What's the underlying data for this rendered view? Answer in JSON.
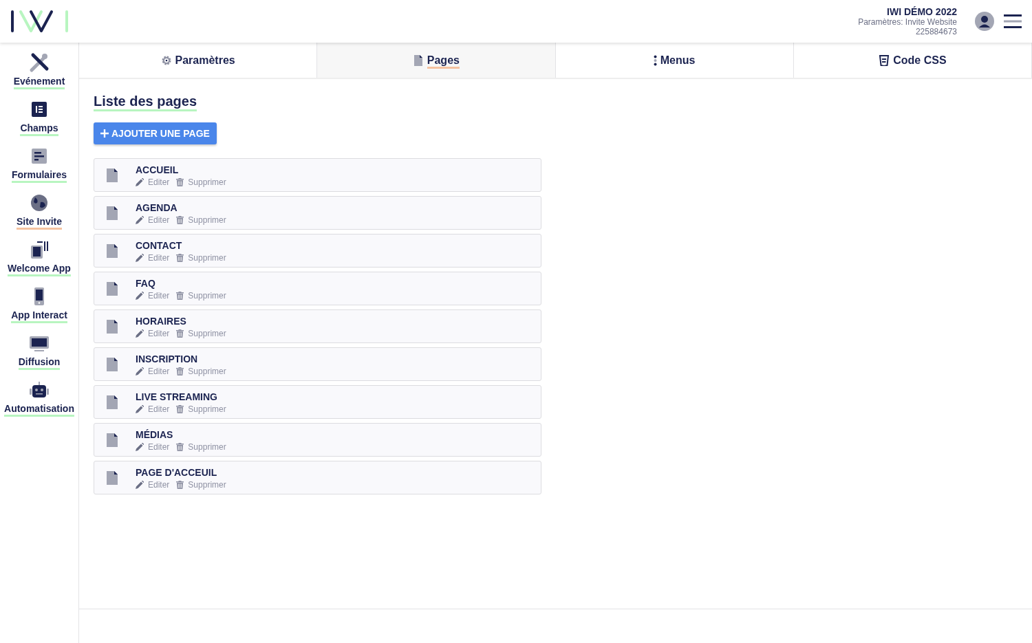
{
  "header": {
    "event_title": "IWI DÉMO 2022",
    "settings_line": "Paramètres: Invite Website",
    "event_id": "225884673"
  },
  "sidebar": {
    "items": [
      {
        "kind": "tools",
        "label": "Evénement",
        "selected": false
      },
      {
        "kind": "fields",
        "label": "Champs",
        "selected": false
      },
      {
        "kind": "form",
        "label": "Formulaires",
        "selected": false
      },
      {
        "kind": "globe",
        "label": "Site Invite",
        "selected": true
      },
      {
        "kind": "kiosk",
        "label": "Welcome App",
        "selected": false
      },
      {
        "kind": "phone",
        "label": "App Interact",
        "selected": false
      },
      {
        "kind": "screen",
        "label": "Diffusion",
        "selected": false
      },
      {
        "kind": "robot",
        "label": "Automatisation",
        "selected": false
      }
    ]
  },
  "tabs": [
    {
      "kind": "gear",
      "label": "Paramètres",
      "selected": false
    },
    {
      "kind": "file",
      "label": "Pages",
      "selected": true
    },
    {
      "kind": "dots",
      "label": "Menus",
      "selected": false
    },
    {
      "kind": "css",
      "label": "Code CSS",
      "selected": false
    }
  ],
  "content": {
    "title": "Liste des pages",
    "add_button": "AJOUTER UNE PAGE",
    "pages": [
      {
        "name": "ACCUEIL",
        "edit": "Editer",
        "delete": "Supprimer"
      },
      {
        "name": "AGENDA",
        "edit": "Editer",
        "delete": "Supprimer"
      },
      {
        "name": "CONTACT",
        "edit": "Editer",
        "delete": "Supprimer"
      },
      {
        "name": "FAQ",
        "edit": "Editer",
        "delete": "Supprimer"
      },
      {
        "name": "HORAIRES",
        "edit": "Editer",
        "delete": "Supprimer"
      },
      {
        "name": "INSCRIPTION",
        "edit": "Editer",
        "delete": "Supprimer"
      },
      {
        "name": "LIVE STREAMING",
        "edit": "Editer",
        "delete": "Supprimer"
      },
      {
        "name": "MÉDIAS",
        "edit": "Editer",
        "delete": "Supprimer"
      },
      {
        "name": "PAGE D'ACCEUIL",
        "edit": "Editer",
        "delete": "Supprimer"
      }
    ]
  }
}
